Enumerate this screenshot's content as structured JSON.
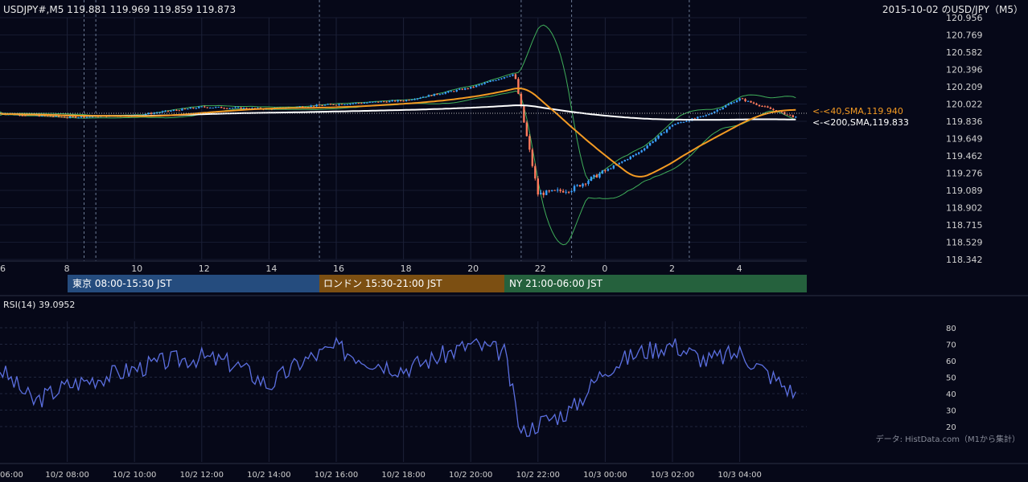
{
  "header": {
    "symbol_line": "USDJPY#,M5 119.881 119.969 119.859 119.873",
    "title_right": "2015-10-02 のUSD/JPY（M5）"
  },
  "price_axis": {
    "ticks": [
      "120.956",
      "120.769",
      "120.582",
      "120.396",
      "120.209",
      "120.022",
      "119.836",
      "119.649",
      "119.462",
      "119.276",
      "119.089",
      "118.902",
      "118.715",
      "118.529",
      "118.342"
    ]
  },
  "time_axis_top": {
    "labels": [
      "6",
      "8",
      "10",
      "12",
      "14",
      "16",
      "18",
      "20",
      "22",
      "0",
      "2",
      "4"
    ]
  },
  "sessions": [
    {
      "label": "東京 08:00-15:30 JST",
      "color": "#254c7e"
    },
    {
      "label": "ロンドン 15:30-21:00 JST",
      "color": "#7c4f12"
    },
    {
      "label": "NY 21:00-06:00 JST",
      "color": "#25613d"
    }
  ],
  "ma_labels": {
    "sma40": "<-<40,SMA,119.940",
    "sma200": "<-<200,SMA,119.833"
  },
  "rsi": {
    "title": "RSI(14) 39.0952",
    "ticks": [
      "80",
      "70",
      "60",
      "50",
      "40",
      "30",
      "20"
    ]
  },
  "time_axis_bottom": {
    "labels": [
      "06:00",
      "10/2 08:00",
      "10/2 10:00",
      "10/2 12:00",
      "10/2 14:00",
      "10/2 16:00",
      "10/2 18:00",
      "10/2 20:00",
      "10/2 22:00",
      "10/3 00:00",
      "10/3 02:00",
      "10/3 04:00"
    ]
  },
  "footer": {
    "credit": "データ: HistData.com（M1から集計）"
  },
  "colors": {
    "background": "#060818",
    "bull": "#3aa0ff",
    "bear": "#ff7a5c",
    "sma40": "#f39a23",
    "sma200": "#ffffff",
    "bollinger": "#3fae5a",
    "rsi_line": "#5b6fe0"
  },
  "chart_data": [
    {
      "type": "line",
      "title": "USDJPY#,M5",
      "x_hours": [
        6,
        8,
        10,
        12,
        14,
        16,
        18,
        20,
        21.3,
        22,
        23,
        0,
        1,
        2,
        3,
        4,
        5.7
      ],
      "close_approx": [
        119.92,
        119.88,
        119.9,
        119.99,
        119.97,
        120.02,
        120.06,
        120.2,
        120.35,
        119.05,
        119.1,
        119.3,
        119.5,
        119.8,
        119.9,
        120.08,
        119.873
      ],
      "series": [
        {
          "name": "40,SMA",
          "last": 119.94
        },
        {
          "name": "200,SMA",
          "last": 119.833
        }
      ],
      "ylim": [
        118.342,
        120.956
      ]
    },
    {
      "type": "line",
      "title": "RSI(14)",
      "last": 39.0952,
      "x_hours": [
        6,
        7,
        8,
        9,
        10,
        11,
        12,
        13,
        14,
        15,
        16,
        17,
        18,
        19,
        20,
        21,
        21.5,
        22,
        23,
        0,
        1,
        2,
        3,
        4,
        5.7
      ],
      "values": [
        55,
        35,
        45,
        50,
        55,
        60,
        62,
        58,
        45,
        60,
        68,
        60,
        55,
        62,
        70,
        65,
        15,
        22,
        30,
        55,
        65,
        70,
        60,
        65,
        39
      ],
      "ylim": [
        15,
        80
      ]
    }
  ]
}
